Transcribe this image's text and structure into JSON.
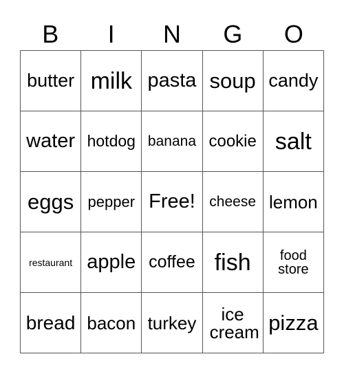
{
  "header": [
    "B",
    "I",
    "N",
    "G",
    "O"
  ],
  "cells": [
    [
      "butter",
      "milk",
      "pasta",
      "soup",
      "candy"
    ],
    [
      "water",
      "hotdog",
      "banana",
      "cookie",
      "salt"
    ],
    [
      "eggs",
      "pepper",
      "Free!",
      "cheese",
      "lemon"
    ],
    [
      "restaurant",
      "apple",
      "coffee",
      "fish",
      "food store"
    ],
    [
      "bread",
      "bacon",
      "turkey",
      "ice cream",
      "pizza"
    ]
  ]
}
